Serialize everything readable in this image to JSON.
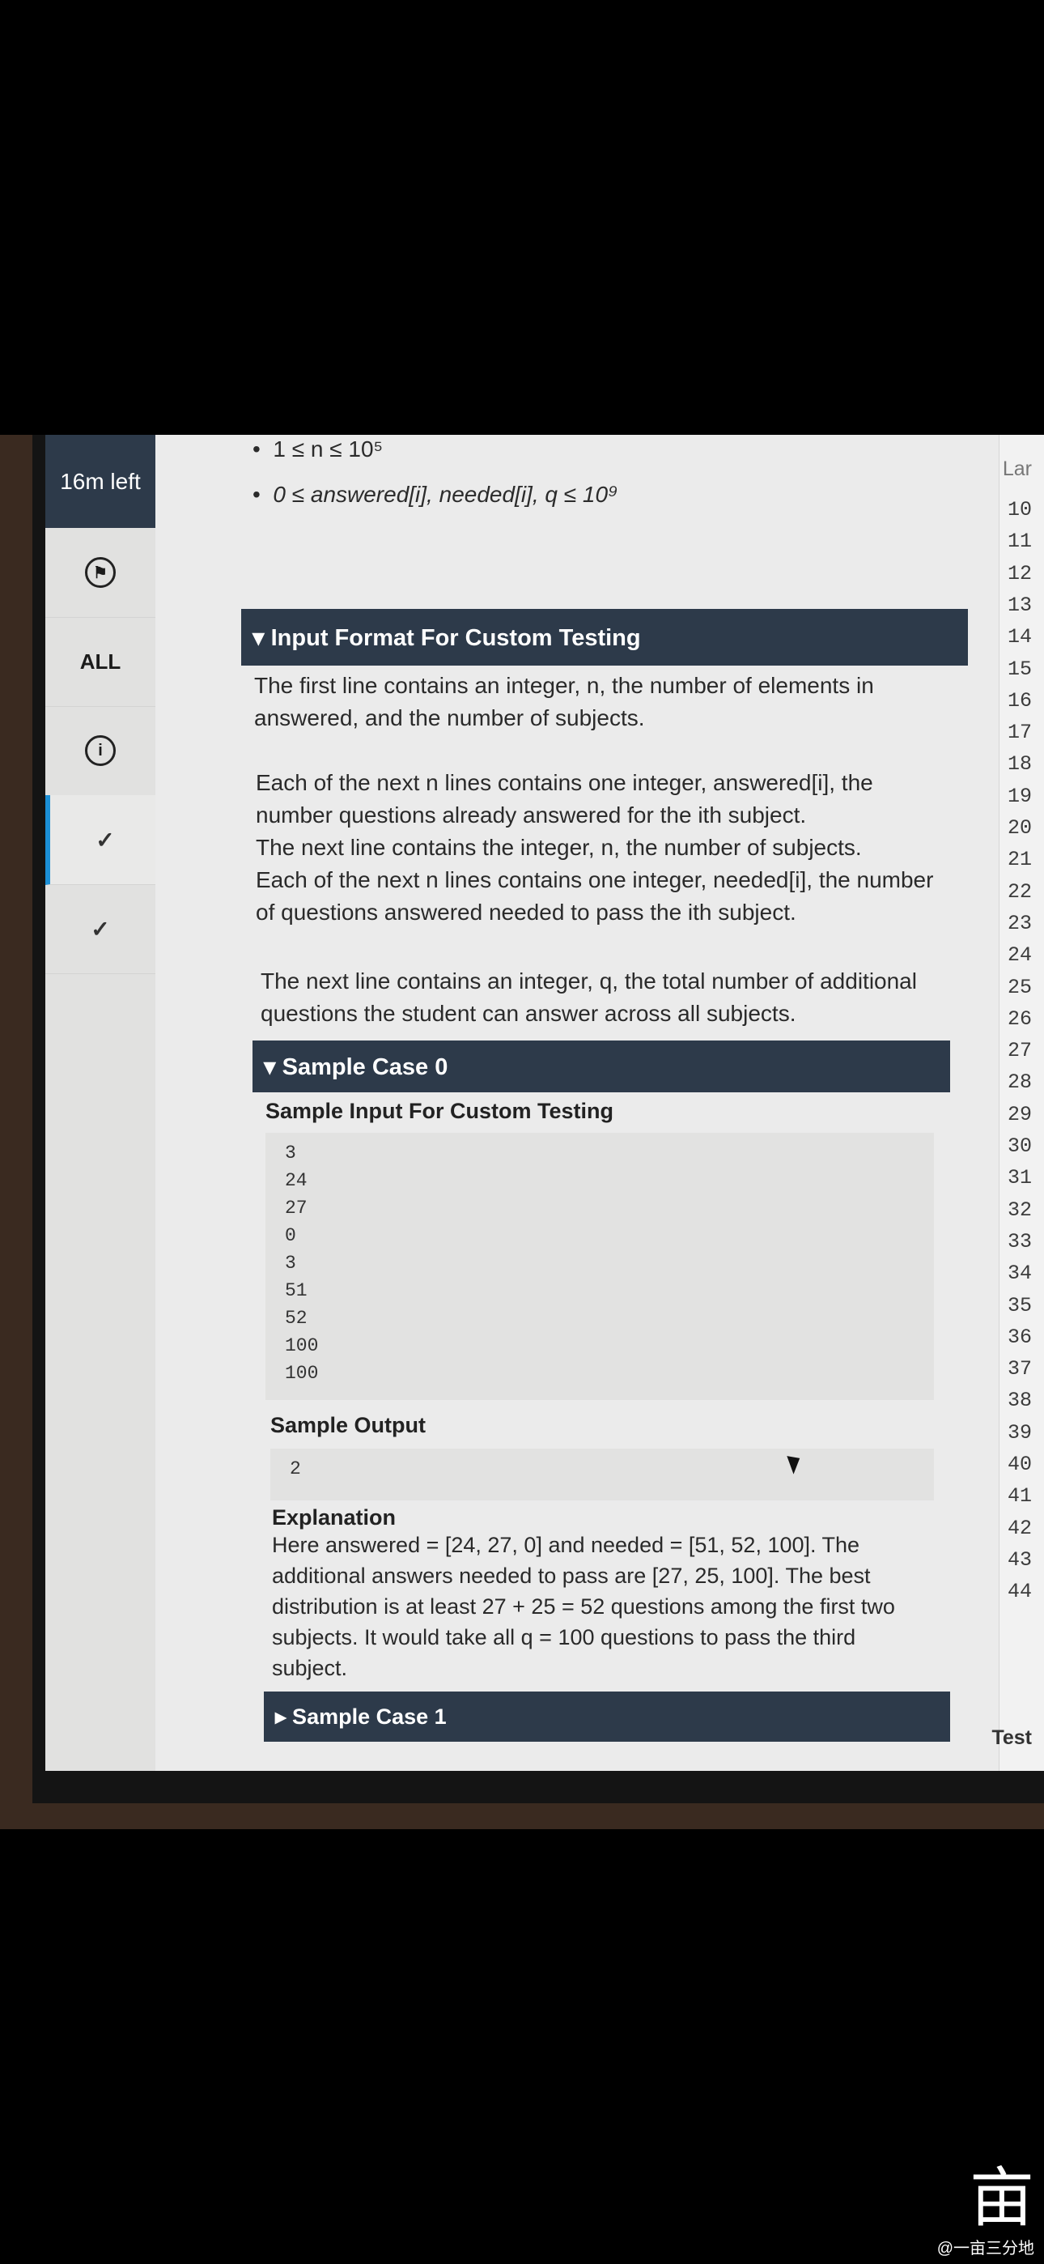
{
  "sidebar": {
    "timer": "16m left",
    "items": [
      {
        "label": "",
        "icon": "flag-icon"
      },
      {
        "label": "ALL"
      },
      {
        "label": "",
        "icon": "info-icon"
      },
      {
        "label": "",
        "icon": "check-icon"
      },
      {
        "label": "",
        "icon": "check-icon"
      }
    ]
  },
  "constraints": [
    "1 ≤ n ≤ 10⁵",
    "0 ≤ answered[i], needed[i], q ≤ 10⁹"
  ],
  "input_format": {
    "header": "▾ Input Format For Custom Testing",
    "p1_line1": "The first line contains an integer, n, the number of elements in",
    "p1_line2": "answered, and the number of subjects.",
    "p2_line1": "Each of the next n lines contains one integer, answered[i], the",
    "p2_line2": "number questions already answered for the ith subject.",
    "p2_line3": "The next line contains the integer, n, the number of subjects.",
    "p2_line4": "Each of the next n lines contains one integer, needed[i], the number",
    "p2_line5": "of questions answered needed to pass the ith subject.",
    "p3_line1": "The next line contains an integer, q, the total number of additional",
    "p3_line2": "questions the student can answer across all subjects."
  },
  "sample0": {
    "header": "▾ Sample Case 0",
    "input_label": "Sample Input For Custom Testing",
    "input_lines": [
      "3",
      "24",
      "27",
      "0",
      "3",
      "51",
      "52",
      "100",
      "100"
    ],
    "output_label": "Sample Output",
    "output": "2",
    "explanation_label": "Explanation",
    "exp_line1": "Here answered = [24, 27, 0] and needed = [51, 52, 100]. The",
    "exp_line2": "additional answers needed to pass are [27, 25, 100]. The best",
    "exp_line3": "distribution is at least 27 + 25 = 52 questions among the first two",
    "exp_line4": "subjects. It would take all q = 100 questions to pass the third",
    "exp_line5": "subject."
  },
  "sample1": {
    "header": "▸ Sample Case 1"
  },
  "editor": {
    "top_label": "Lar",
    "line_numbers": [
      "10",
      "11",
      "12",
      "13",
      "14",
      "15",
      "16",
      "17",
      "18",
      "19",
      "20",
      "21",
      "22",
      "23",
      "24",
      "25",
      "26",
      "27",
      "28",
      "29",
      "30",
      "31",
      "32",
      "33",
      "34",
      "35",
      "36",
      "37",
      "38",
      "39",
      "40",
      "41",
      "42",
      "43",
      "44"
    ],
    "bottom_label": "Test"
  },
  "watermark": {
    "logo": "亩",
    "text": "@一亩三分地"
  }
}
